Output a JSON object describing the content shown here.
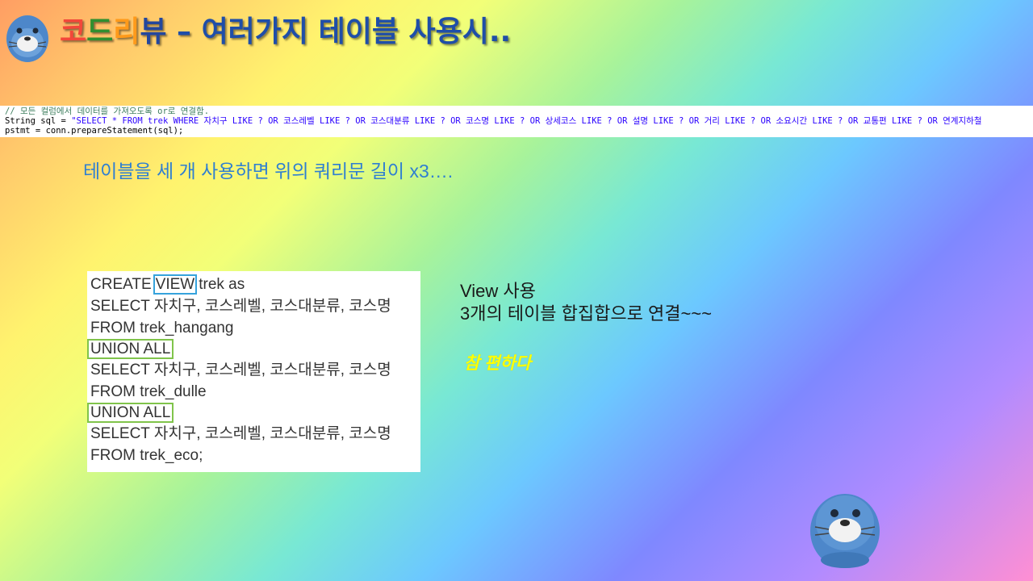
{
  "title": {
    "part1": "코",
    "part2": "드",
    "part3": "리",
    "part4": "뷰",
    "rest": " – 여러가지 테이블 사용시.."
  },
  "code_snippet": {
    "line1": "// 모든 컬럼에서 데이터를 가져오도록 or로 연결함.",
    "line2_prefix": "String sql = ",
    "line2_string": "\"SELECT * FROM trek WHERE 자치구 LIKE ? OR 코스레벨 LIKE ? OR 코스대분류 LIKE ? OR 코스명 LIKE ? OR 상세코스 LIKE ? OR 설명 LIKE ? OR 거리 LIKE ? OR 소요시간 LIKE ? OR 교통편 LIKE ? OR 연계지하철",
    "line3": "pstmt = conn.prepareStatement(sql);"
  },
  "subheading": "테이블을 세 개 사용하면 위의 쿼리문 길이 x3….",
  "sql": {
    "line1_a": "CREATE",
    "line1_view": "VIEW",
    "line1_b": "trek as",
    "line2": "SELECT 자치구, 코스레벨, 코스대분류, 코스명",
    "line3": "FROM trek_hangang",
    "line4": "UNION ALL",
    "line5": "SELECT 자치구, 코스레벨, 코스대분류, 코스명",
    "line6": "FROM trek_dulle",
    "line7": "UNION ALL",
    "line8": "SELECT 자치구, 코스레벨, 코스대분류, 코스명",
    "line9": "FROM trek_eco;"
  },
  "notes": {
    "line1": "View 사용",
    "line2": "3개의 테이블 합집합으로 연결~~~",
    "italic": "참 편하다"
  },
  "colors": {
    "view_highlight": "#36a3dc",
    "union_highlight": "#80c44b",
    "subheading": "#2f7fd1",
    "italic_note": "#ffff00"
  }
}
